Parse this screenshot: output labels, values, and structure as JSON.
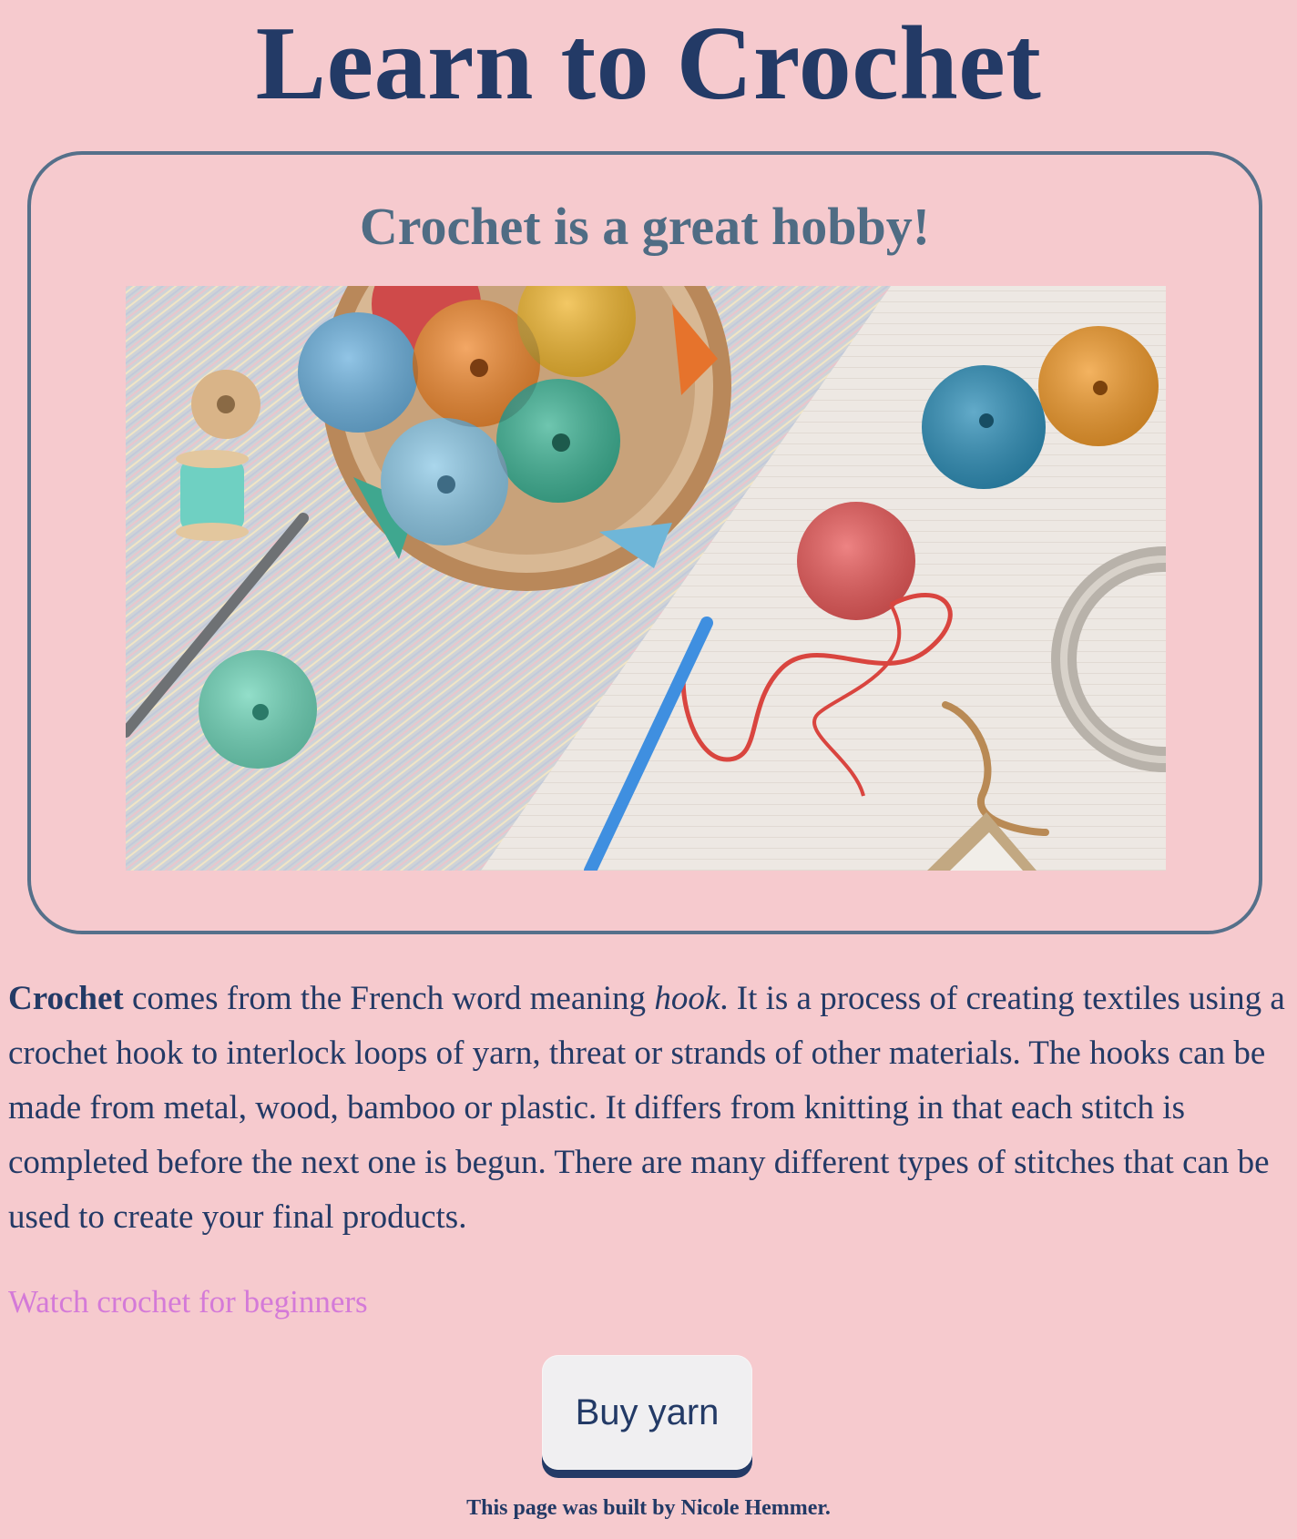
{
  "page": {
    "title": "Learn to Crochet"
  },
  "card": {
    "heading": "Crochet is a great hobby!"
  },
  "intro": {
    "bold_word": "Crochet",
    "text_1": " comes from the French word meaning ",
    "italic_word": "hook",
    "text_2": ". It is a process of creating textiles using a crochet hook to interlock loops of yarn, threat or strands of other materials. The hooks can be made from metal, wood, bamboo or plastic. It differs from knitting in that each stitch is completed before the next one is begun. There are many different types of stitches that can be used to create your final products."
  },
  "link": {
    "label": "Watch crochet for beginners"
  },
  "button": {
    "label": "Buy yarn"
  },
  "footer": {
    "credit": "This page was built by Nicole Hemmer."
  },
  "colors": {
    "background": "#f6cace",
    "title": "#233a66",
    "card_border": "#55708a",
    "card_heading": "#4f6c84",
    "link": "#d47ad8",
    "button_bg": "#f0eff1"
  }
}
